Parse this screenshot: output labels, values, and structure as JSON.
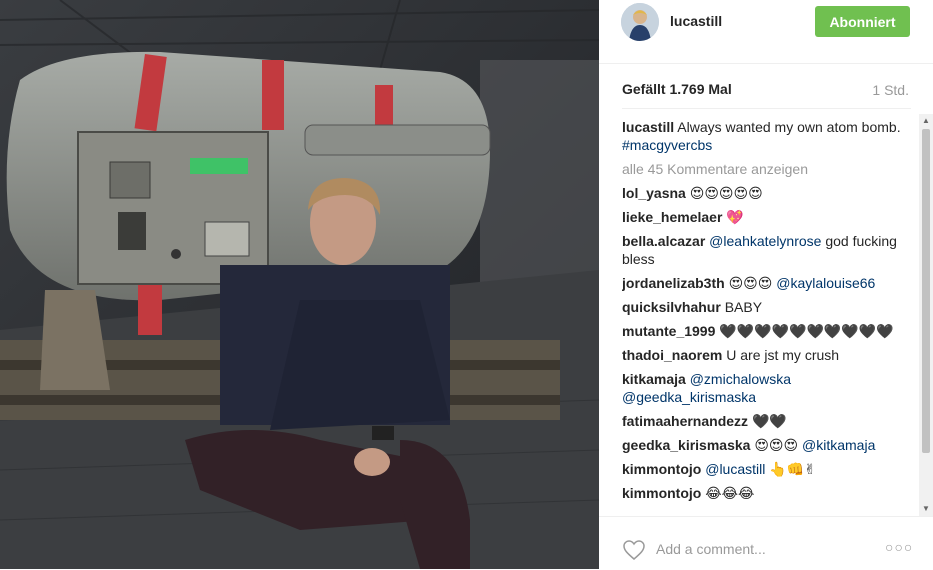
{
  "post": {
    "username": "lucastill",
    "follow_label": "Abonniert",
    "likes": "Gefällt 1.769 Mal",
    "time": "1 Std."
  },
  "caption": {
    "user": "lucastill",
    "text": "Always wanted my own atom bomb. ",
    "hashtag": "#macgyvercbs"
  },
  "more_comments": "alle 45 Kommentare anzeigen",
  "comments": [
    {
      "user": "lol_yasna",
      "text": "😍😍😍😍😍"
    },
    {
      "user": "lieke_hemelaer",
      "text": "💖"
    },
    {
      "user": "bella.alcazar",
      "mention": "@leahkatelynrose",
      "text": " god fucking bless"
    },
    {
      "user": "jordanelizab3th",
      "text": "😍😍😍 ",
      "mention": "@kaylalouise66"
    },
    {
      "user": "quicksilvhahur",
      "text": "BABY"
    },
    {
      "user": "mutante_1999",
      "text": "🖤🖤🖤🖤🖤🖤🖤🖤🖤🖤"
    },
    {
      "user": "thadoi_naorem",
      "text": "U are jst my crush"
    },
    {
      "user": "kitkamaja",
      "mention": "@zmichalowska @geedka_kirismaska",
      "text": ""
    },
    {
      "user": "fatimaahernandezz",
      "text": "🖤🖤"
    },
    {
      "user": "geedka_kirismaska",
      "text": "😍😍😍 ",
      "mention": "@kitkamaja"
    },
    {
      "user": "kimmontojo",
      "mention": "@lucastill",
      "text": " 👆👊✌"
    },
    {
      "user": "kimmontojo",
      "text": "😂😂😂"
    }
  ],
  "add_comment_placeholder": "Add a comment...",
  "colors": {
    "follow_bg": "#70c050",
    "link": "#003569",
    "muted": "#999999"
  }
}
